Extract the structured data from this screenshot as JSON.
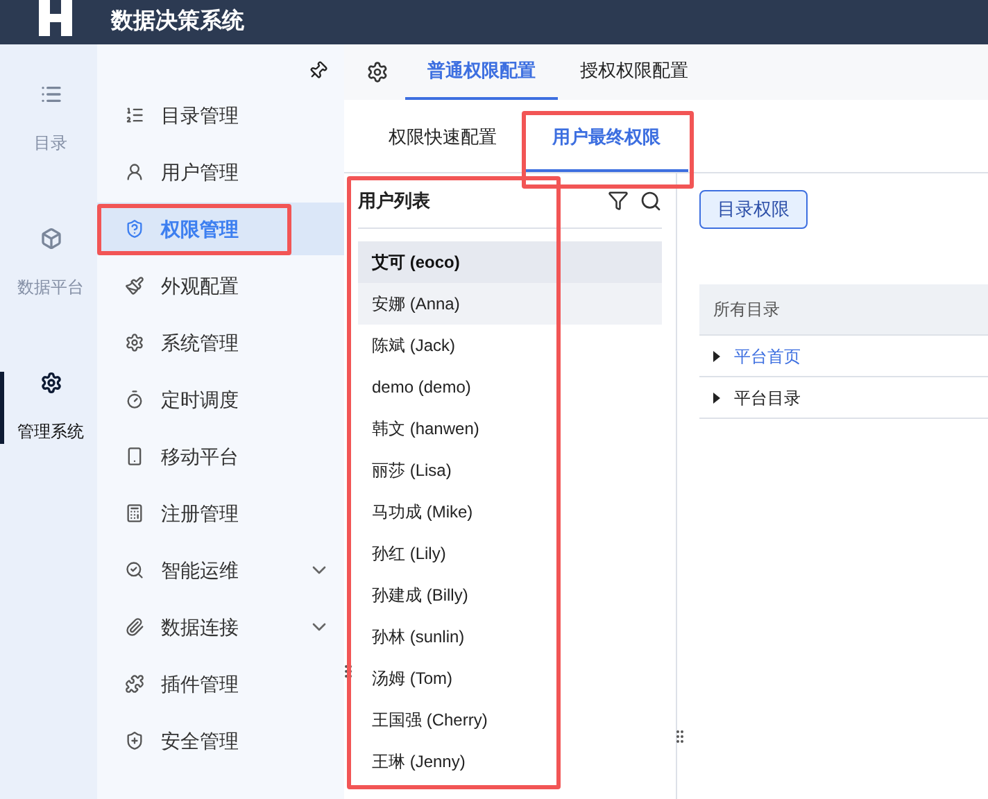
{
  "header": {
    "title": "数据决策系统"
  },
  "rail": [
    {
      "label": "目录",
      "selected": false
    },
    {
      "label": "数据平台",
      "selected": false
    },
    {
      "label": "管理系统",
      "selected": true
    }
  ],
  "menu": [
    {
      "label": "目录管理",
      "selected": false,
      "expandable": false
    },
    {
      "label": "用户管理",
      "selected": false,
      "expandable": false
    },
    {
      "label": "权限管理",
      "selected": true,
      "expandable": false
    },
    {
      "label": "外观配置",
      "selected": false,
      "expandable": false
    },
    {
      "label": "系统管理",
      "selected": false,
      "expandable": false
    },
    {
      "label": "定时调度",
      "selected": false,
      "expandable": false
    },
    {
      "label": "移动平台",
      "selected": false,
      "expandable": false
    },
    {
      "label": "注册管理",
      "selected": false,
      "expandable": false
    },
    {
      "label": "智能运维",
      "selected": false,
      "expandable": true
    },
    {
      "label": "数据连接",
      "selected": false,
      "expandable": true
    },
    {
      "label": "插件管理",
      "selected": false,
      "expandable": false
    },
    {
      "label": "安全管理",
      "selected": false,
      "expandable": false
    }
  ],
  "tabs": [
    {
      "label": "普通权限配置",
      "selected": true
    },
    {
      "label": "授权权限配置",
      "selected": false
    }
  ],
  "subtabs": [
    {
      "label": "权限快速配置",
      "selected": false
    },
    {
      "label": "用户最终权限",
      "selected": true
    }
  ],
  "user_list": {
    "title": "用户列表",
    "users": [
      {
        "name": "艾可 (eoco)",
        "selected": true,
        "hovered": false
      },
      {
        "name": "安娜 (Anna)",
        "selected": false,
        "hovered": true
      },
      {
        "name": "陈斌 (Jack)",
        "selected": false,
        "hovered": false
      },
      {
        "name": "demo (demo)",
        "selected": false,
        "hovered": false
      },
      {
        "name": "韩文 (hanwen)",
        "selected": false,
        "hovered": false
      },
      {
        "name": "丽莎 (Lisa)",
        "selected": false,
        "hovered": false
      },
      {
        "name": "马功成 (Mike)",
        "selected": false,
        "hovered": false
      },
      {
        "name": "孙红 (Lily)",
        "selected": false,
        "hovered": false
      },
      {
        "name": "孙建成 (Billy)",
        "selected": false,
        "hovered": false
      },
      {
        "name": "孙林 (sunlin)",
        "selected": false,
        "hovered": false
      },
      {
        "name": "汤姆 (Tom)",
        "selected": false,
        "hovered": false
      },
      {
        "name": "王国强 (Cherry)",
        "selected": false,
        "hovered": false
      },
      {
        "name": "王琳 (Jenny)",
        "selected": false,
        "hovered": false
      }
    ]
  },
  "permissions": {
    "button": "目录权限",
    "column": "所有目录",
    "rows": [
      {
        "label": "平台首页",
        "selected": true
      },
      {
        "label": "平台目录",
        "selected": false
      }
    ]
  }
}
